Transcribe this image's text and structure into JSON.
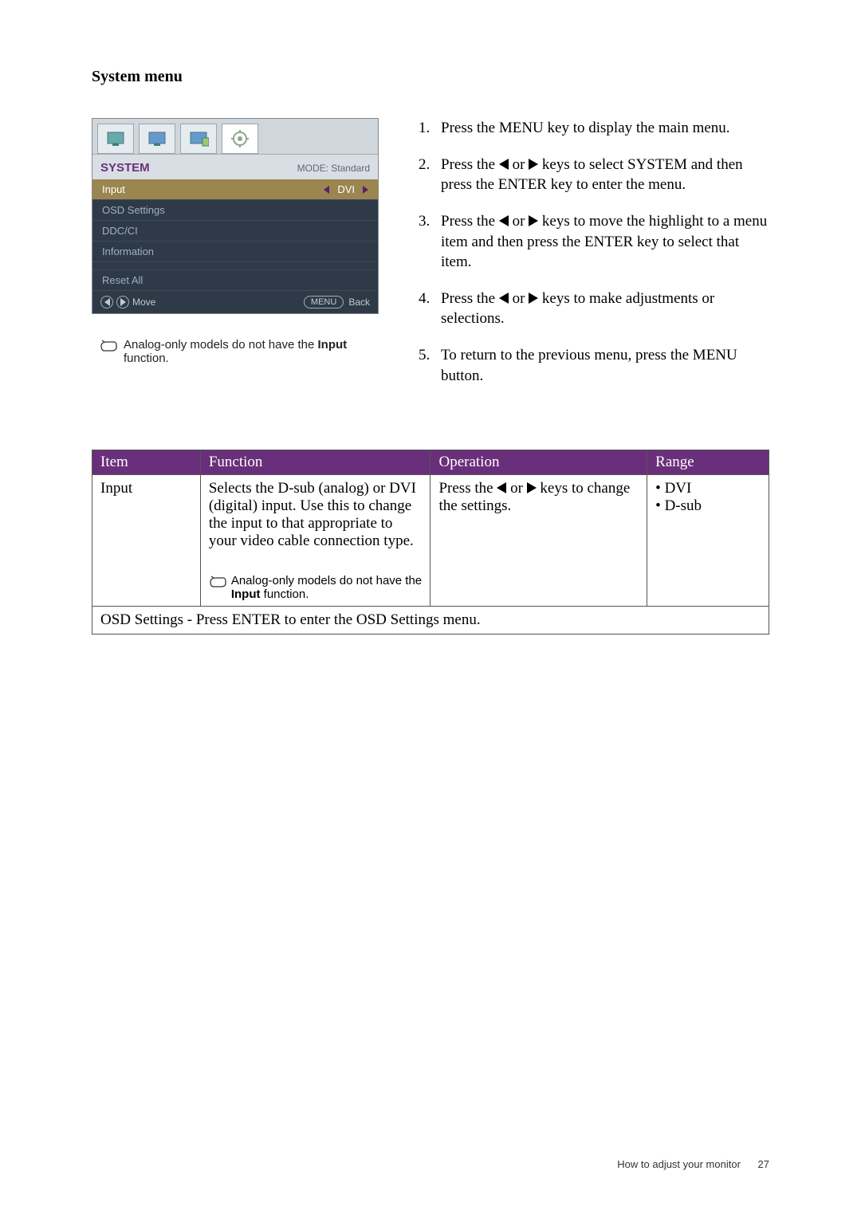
{
  "title": "System menu",
  "osd": {
    "header": "SYSTEM",
    "mode_label": "MODE: Standard",
    "rows": {
      "input": "Input",
      "input_value": "DVI",
      "osd_settings": "OSD Settings",
      "ddcci": "DDC/CI",
      "information": "Information",
      "reset_all": "Reset All"
    },
    "footer": {
      "move": "Move",
      "menu": "MENU",
      "back": "Back"
    }
  },
  "left_note": {
    "pre": "Analog-only models do not have the ",
    "bold": "Input",
    "post": " function."
  },
  "instructions": {
    "s1_a": "Press the ",
    "s1_b": "MENU",
    "s1_c": " key to display the main menu.",
    "s2_a": "Press the ",
    "s2_b": " or ",
    "s2_c": " keys to select ",
    "s2_d": "SYSTEM",
    "s2_e": " and then press the ",
    "s2_f": "ENTER",
    "s2_g": " key to enter the menu.",
    "s3_a": "Press the ",
    "s3_b": " or ",
    "s3_c": " keys to move the highlight to a menu item and then press the ",
    "s3_d": "ENTER",
    "s3_e": " key to select that item.",
    "s4_a": "Press the ",
    "s4_b": " or ",
    "s4_c": " keys to make adjustments or selections.",
    "s5_a": "To return to the previous menu, press the ",
    "s5_b": "MENU",
    "s5_c": " button."
  },
  "table": {
    "headers": {
      "item": "Item",
      "function": "Function",
      "operation": "Operation",
      "range": "Range"
    },
    "row1": {
      "item": "Input",
      "func_main": "Selects the D-sub (analog) or DVI (digital) input. Use this to change the input to that appropriate to your video cable connection type.",
      "func_note_pre": "Analog-only models do not have the ",
      "func_note_bold": "Input",
      "func_note_post": " function.",
      "op_a": "Press the ",
      "op_b": " or ",
      "op_c": " keys to change the settings.",
      "range1": "DVI",
      "range2": "D-sub"
    },
    "row2_a": "OSD Settings",
    "row2_b": " - Press ",
    "row2_c": "ENTER",
    "row2_d": " to enter the ",
    "row2_e": "OSD Settings",
    "row2_f": " menu."
  },
  "footer": {
    "text": "How to adjust your monitor",
    "page": "27"
  }
}
